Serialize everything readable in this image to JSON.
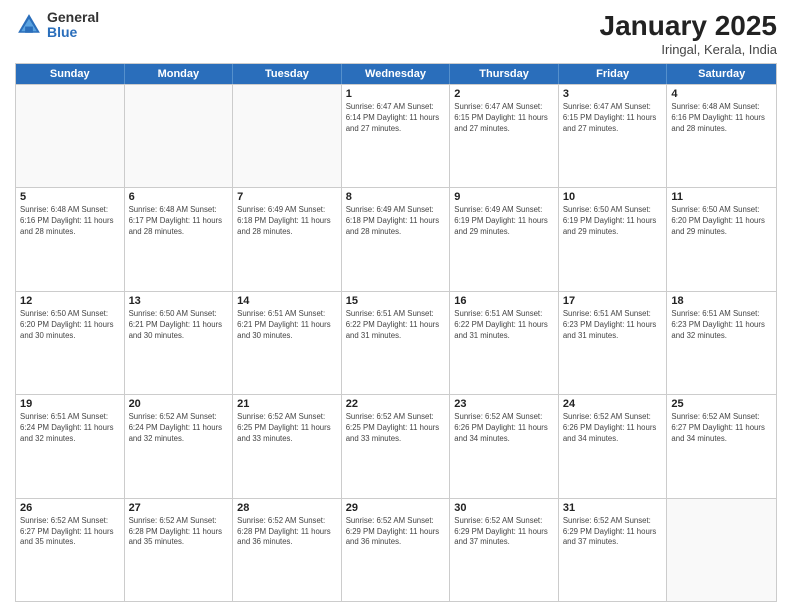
{
  "header": {
    "logo_general": "General",
    "logo_blue": "Blue",
    "title": "January 2025",
    "subtitle": "Iringal, Kerala, India"
  },
  "weekdays": [
    "Sunday",
    "Monday",
    "Tuesday",
    "Wednesday",
    "Thursday",
    "Friday",
    "Saturday"
  ],
  "weeks": [
    [
      {
        "day": "",
        "info": ""
      },
      {
        "day": "",
        "info": ""
      },
      {
        "day": "",
        "info": ""
      },
      {
        "day": "1",
        "info": "Sunrise: 6:47 AM\nSunset: 6:14 PM\nDaylight: 11 hours and 27 minutes."
      },
      {
        "day": "2",
        "info": "Sunrise: 6:47 AM\nSunset: 6:15 PM\nDaylight: 11 hours and 27 minutes."
      },
      {
        "day": "3",
        "info": "Sunrise: 6:47 AM\nSunset: 6:15 PM\nDaylight: 11 hours and 27 minutes."
      },
      {
        "day": "4",
        "info": "Sunrise: 6:48 AM\nSunset: 6:16 PM\nDaylight: 11 hours and 28 minutes."
      }
    ],
    [
      {
        "day": "5",
        "info": "Sunrise: 6:48 AM\nSunset: 6:16 PM\nDaylight: 11 hours and 28 minutes."
      },
      {
        "day": "6",
        "info": "Sunrise: 6:48 AM\nSunset: 6:17 PM\nDaylight: 11 hours and 28 minutes."
      },
      {
        "day": "7",
        "info": "Sunrise: 6:49 AM\nSunset: 6:18 PM\nDaylight: 11 hours and 28 minutes."
      },
      {
        "day": "8",
        "info": "Sunrise: 6:49 AM\nSunset: 6:18 PM\nDaylight: 11 hours and 28 minutes."
      },
      {
        "day": "9",
        "info": "Sunrise: 6:49 AM\nSunset: 6:19 PM\nDaylight: 11 hours and 29 minutes."
      },
      {
        "day": "10",
        "info": "Sunrise: 6:50 AM\nSunset: 6:19 PM\nDaylight: 11 hours and 29 minutes."
      },
      {
        "day": "11",
        "info": "Sunrise: 6:50 AM\nSunset: 6:20 PM\nDaylight: 11 hours and 29 minutes."
      }
    ],
    [
      {
        "day": "12",
        "info": "Sunrise: 6:50 AM\nSunset: 6:20 PM\nDaylight: 11 hours and 30 minutes."
      },
      {
        "day": "13",
        "info": "Sunrise: 6:50 AM\nSunset: 6:21 PM\nDaylight: 11 hours and 30 minutes."
      },
      {
        "day": "14",
        "info": "Sunrise: 6:51 AM\nSunset: 6:21 PM\nDaylight: 11 hours and 30 minutes."
      },
      {
        "day": "15",
        "info": "Sunrise: 6:51 AM\nSunset: 6:22 PM\nDaylight: 11 hours and 31 minutes."
      },
      {
        "day": "16",
        "info": "Sunrise: 6:51 AM\nSunset: 6:22 PM\nDaylight: 11 hours and 31 minutes."
      },
      {
        "day": "17",
        "info": "Sunrise: 6:51 AM\nSunset: 6:23 PM\nDaylight: 11 hours and 31 minutes."
      },
      {
        "day": "18",
        "info": "Sunrise: 6:51 AM\nSunset: 6:23 PM\nDaylight: 11 hours and 32 minutes."
      }
    ],
    [
      {
        "day": "19",
        "info": "Sunrise: 6:51 AM\nSunset: 6:24 PM\nDaylight: 11 hours and 32 minutes."
      },
      {
        "day": "20",
        "info": "Sunrise: 6:52 AM\nSunset: 6:24 PM\nDaylight: 11 hours and 32 minutes."
      },
      {
        "day": "21",
        "info": "Sunrise: 6:52 AM\nSunset: 6:25 PM\nDaylight: 11 hours and 33 minutes."
      },
      {
        "day": "22",
        "info": "Sunrise: 6:52 AM\nSunset: 6:25 PM\nDaylight: 11 hours and 33 minutes."
      },
      {
        "day": "23",
        "info": "Sunrise: 6:52 AM\nSunset: 6:26 PM\nDaylight: 11 hours and 34 minutes."
      },
      {
        "day": "24",
        "info": "Sunrise: 6:52 AM\nSunset: 6:26 PM\nDaylight: 11 hours and 34 minutes."
      },
      {
        "day": "25",
        "info": "Sunrise: 6:52 AM\nSunset: 6:27 PM\nDaylight: 11 hours and 34 minutes."
      }
    ],
    [
      {
        "day": "26",
        "info": "Sunrise: 6:52 AM\nSunset: 6:27 PM\nDaylight: 11 hours and 35 minutes."
      },
      {
        "day": "27",
        "info": "Sunrise: 6:52 AM\nSunset: 6:28 PM\nDaylight: 11 hours and 35 minutes."
      },
      {
        "day": "28",
        "info": "Sunrise: 6:52 AM\nSunset: 6:28 PM\nDaylight: 11 hours and 36 minutes."
      },
      {
        "day": "29",
        "info": "Sunrise: 6:52 AM\nSunset: 6:29 PM\nDaylight: 11 hours and 36 minutes."
      },
      {
        "day": "30",
        "info": "Sunrise: 6:52 AM\nSunset: 6:29 PM\nDaylight: 11 hours and 37 minutes."
      },
      {
        "day": "31",
        "info": "Sunrise: 6:52 AM\nSunset: 6:29 PM\nDaylight: 11 hours and 37 minutes."
      },
      {
        "day": "",
        "info": ""
      }
    ]
  ]
}
